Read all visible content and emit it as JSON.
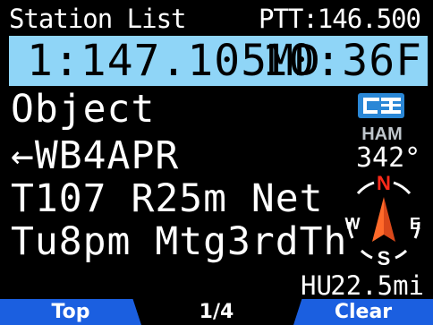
{
  "header": {
    "title": "Station List",
    "ptt": "PTT:146.500"
  },
  "frequency_bar": {
    "frequency": "1:147.105MD",
    "time": "10:36F"
  },
  "station": {
    "type": "Object",
    "source": "←WB4APR",
    "comment1": "T107 R25m Net",
    "comment2": "Tu8pm Mtg3rdTh",
    "bearing": "342°",
    "grid": "HU",
    "distance": "22.5mi"
  },
  "logo": {
    "text": "HAM"
  },
  "compass": {
    "north": "N",
    "south": "S",
    "east": "E",
    "west": "W"
  },
  "softkeys": {
    "left": "Top",
    "middle": "1/4",
    "right": "Clear"
  },
  "colors": {
    "bar": "#8fd5f7",
    "softkey": "#1b5fe0",
    "north": "#ff2a1a",
    "pointer": "#ff5a1f",
    "logo_blue": "#2a87d6",
    "logo_gray": "#bfc6cc"
  }
}
